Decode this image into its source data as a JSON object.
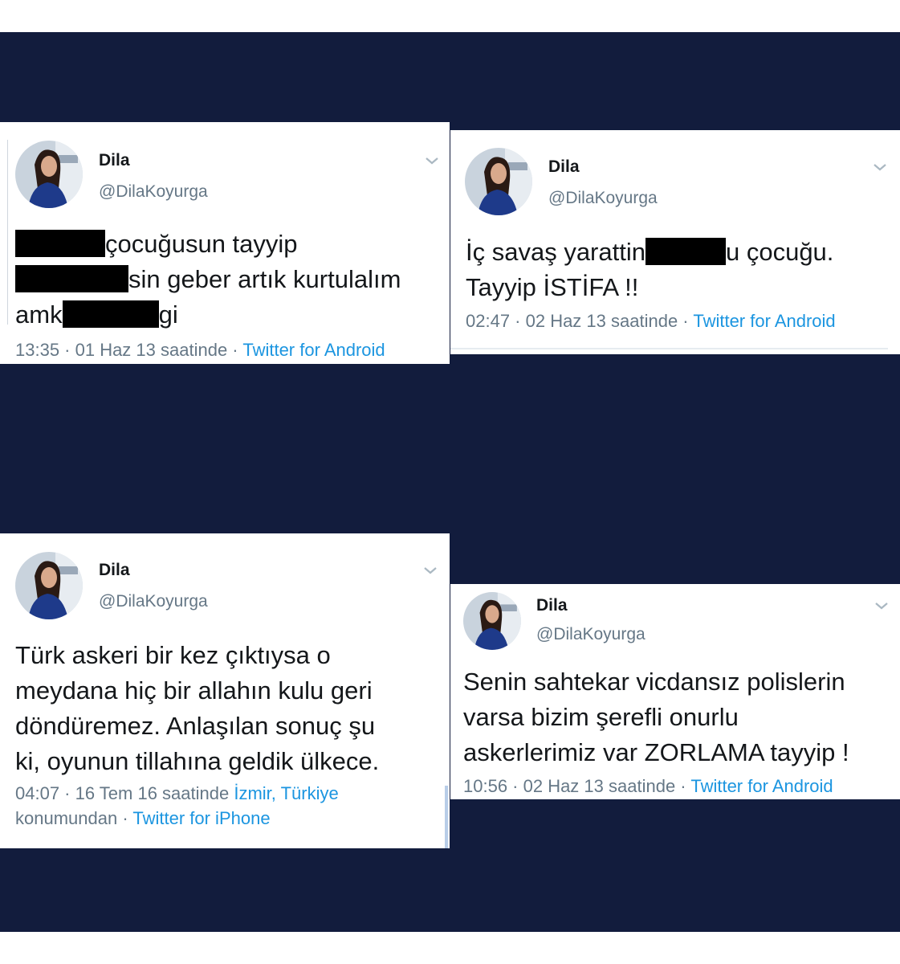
{
  "tweets": [
    {
      "name": "Dila",
      "handle": "@DilaKoyurga",
      "line1_after": "çocuğusun tayyip",
      "line2_after": "sin geber artık kurtulalım",
      "line3_before": "amk",
      "line3_after": "gi",
      "time": "13:35 · 01 Haz 13 saatinde · ",
      "source": "Twitter for Android"
    },
    {
      "name": "Dila",
      "handle": "@DilaKoyurga",
      "line1_before": "İç savaş yarattin",
      "line1_after": "u çocuğu.",
      "line2": "Tayyip İSTİFA !!",
      "time": "02:47 · 02 Haz 13 saatinde · ",
      "source": "Twitter for Android"
    },
    {
      "name": "Dila",
      "handle": "@DilaKoyurga",
      "lines": [
        "Türk askeri bir kez çıktıysa o",
        "meydana hiç bir allahın kulu geri",
        "döndüremez. Anlaşılan sonuç şu",
        "ki, oyunun tillahına geldik ülkece."
      ],
      "time": "04:07 · 16 Tem 16 saatinde ",
      "location": "İzmir, Türkiye",
      "time_line2": "konumundan · ",
      "source": "Twitter for iPhone"
    },
    {
      "name": "Dila",
      "handle": "@DilaKoyurga",
      "lines": [
        "Senin sahtekar vicdansız polislerin",
        "varsa bizim şerefli onurlu",
        "askerlerimiz var ZORLAMA tayyip !"
      ],
      "time": "10:56 · 02 Haz 13 saatinde · ",
      "source": "Twitter for Android"
    }
  ],
  "colors": {
    "background": "#121c3d",
    "card": "#ffffff",
    "text": "#14171a",
    "muted": "#657786",
    "link": "#1b95e0",
    "redaction": "#000000"
  },
  "icons": {
    "avatar": "profile-photo",
    "chevron": "chevron-down-icon"
  }
}
